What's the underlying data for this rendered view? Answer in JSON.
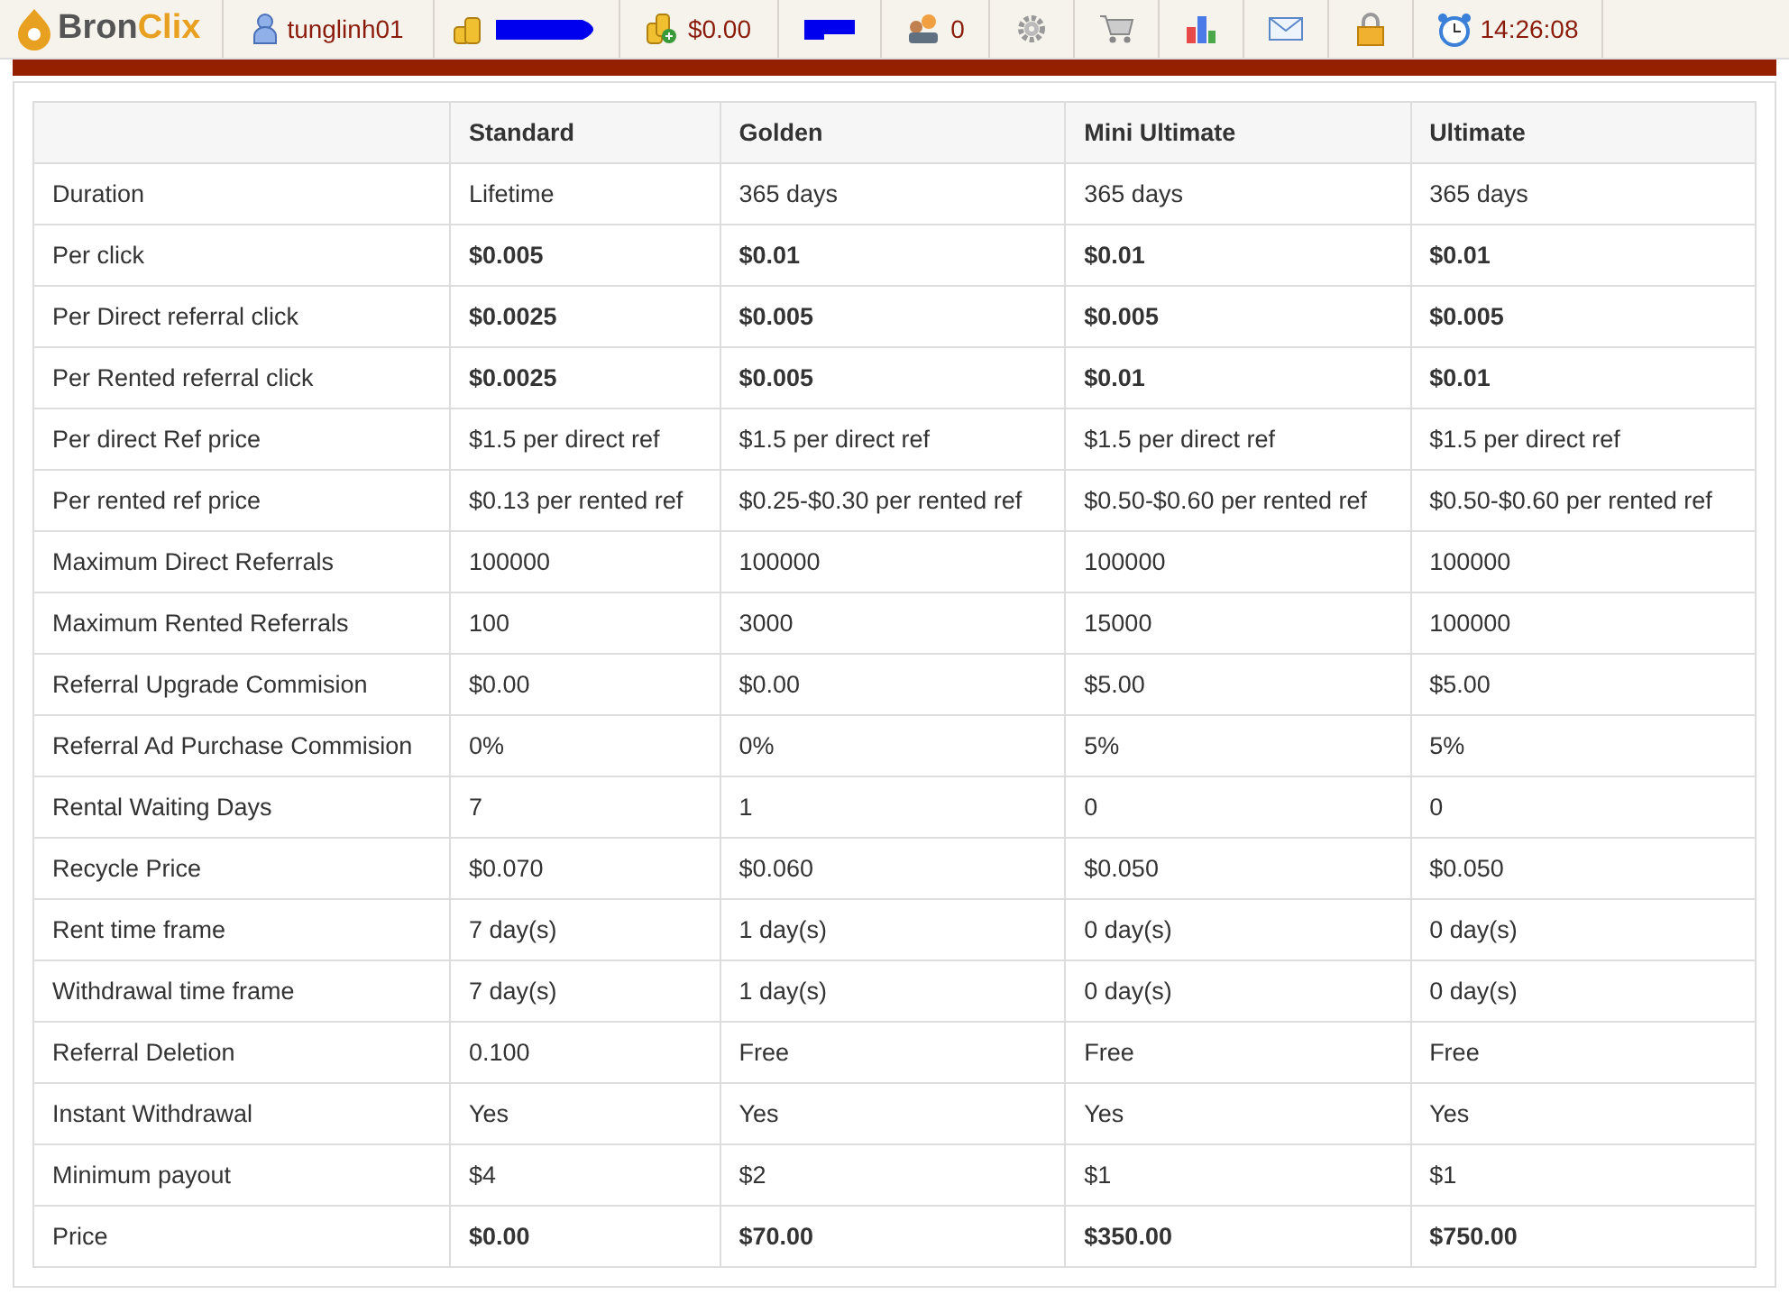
{
  "topbar": {
    "logo": {
      "part1": "Bron",
      "part2": "Clix"
    },
    "items": [
      {
        "kind": "user",
        "text": "tunglinh01"
      },
      {
        "kind": "coins-redacted"
      },
      {
        "kind": "coins-add",
        "text": "$0.00"
      },
      {
        "kind": "redacted"
      },
      {
        "kind": "referrals",
        "text": "0"
      },
      {
        "kind": "settings"
      },
      {
        "kind": "cart"
      },
      {
        "kind": "stats"
      },
      {
        "kind": "mail"
      },
      {
        "kind": "lock"
      },
      {
        "kind": "clock",
        "text": "14:26:08"
      }
    ]
  },
  "table": {
    "columns": [
      "Standard",
      "Golden",
      "Mini Ultimate",
      "Ultimate"
    ],
    "rows": [
      {
        "label": "Duration",
        "emphasis": false,
        "cells": [
          "Lifetime",
          "365 days",
          "365 days",
          "365 days"
        ]
      },
      {
        "label": "Per click",
        "emphasis": true,
        "cells": [
          "$0.005",
          "$0.01",
          "$0.01",
          "$0.01"
        ]
      },
      {
        "label": "Per Direct referral click",
        "emphasis": true,
        "cells": [
          "$0.0025",
          "$0.005",
          "$0.005",
          "$0.005"
        ]
      },
      {
        "label": "Per Rented referral click",
        "emphasis": true,
        "cells": [
          "$0.0025",
          "$0.005",
          "$0.01",
          "$0.01"
        ]
      },
      {
        "label": "Per direct Ref price",
        "emphasis": false,
        "cells": [
          "$1.5 per direct ref",
          "$1.5 per direct ref",
          "$1.5 per direct ref",
          "$1.5 per direct ref"
        ]
      },
      {
        "label": "Per rented ref price",
        "emphasis": false,
        "cells": [
          "$0.13 per rented ref",
          "$0.25-$0.30 per rented ref",
          "$0.50-$0.60 per rented ref",
          "$0.50-$0.60 per rented ref"
        ]
      },
      {
        "label": "Maximum Direct Referrals",
        "emphasis": false,
        "cells": [
          "100000",
          "100000",
          "100000",
          "100000"
        ]
      },
      {
        "label": "Maximum Rented Referrals",
        "emphasis": false,
        "cells": [
          "100",
          "3000",
          "15000",
          "100000"
        ]
      },
      {
        "label": "Referral Upgrade Commision",
        "emphasis": false,
        "cells": [
          "$0.00",
          "$0.00",
          "$5.00",
          "$5.00"
        ]
      },
      {
        "label": "Referral Ad Purchase Commision",
        "emphasis": false,
        "cells": [
          "0%",
          "0%",
          "5%",
          "5%"
        ]
      },
      {
        "label": "Rental Waiting Days",
        "emphasis": false,
        "cells": [
          "7",
          "1",
          "0",
          "0"
        ]
      },
      {
        "label": "Recycle Price",
        "emphasis": false,
        "cells": [
          "$0.070",
          "$0.060",
          "$0.050",
          "$0.050"
        ]
      },
      {
        "label": "Rent time frame",
        "emphasis": false,
        "cells": [
          "7 day(s)",
          "1 day(s)",
          "0 day(s)",
          "0 day(s)"
        ]
      },
      {
        "label": "Withdrawal time frame",
        "emphasis": false,
        "cells": [
          "7 day(s)",
          "1 day(s)",
          "0 day(s)",
          "0 day(s)"
        ]
      },
      {
        "label": "Referral Deletion",
        "emphasis": false,
        "cells": [
          "0.100",
          "Free",
          "Free",
          "Free"
        ]
      },
      {
        "label": "Instant Withdrawal",
        "emphasis": false,
        "cells": [
          "Yes",
          "Yes",
          "Yes",
          "Yes"
        ]
      },
      {
        "label": "Minimum payout",
        "emphasis": false,
        "cells": [
          "$4",
          "$2",
          "$1",
          "$1"
        ]
      },
      {
        "label": "Price",
        "emphasis": true,
        "cells": [
          "$0.00",
          "$70.00",
          "$350.00",
          "$750.00"
        ]
      }
    ]
  }
}
